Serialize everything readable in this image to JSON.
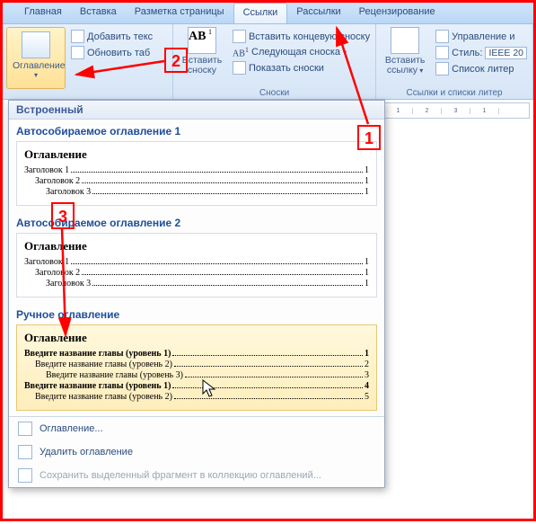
{
  "tabs": {
    "home": "Главная",
    "insert": "Вставка",
    "layout": "Разметка страницы",
    "references": "Ссылки",
    "mailings": "Рассылки",
    "review": "Рецензирование"
  },
  "ribbon": {
    "toc": {
      "label": "Оглавление",
      "add_text": "Добавить текс",
      "update_table": "Обновить таб"
    },
    "footnotes": {
      "group_label": "Сноски",
      "insert_footnote_l1": "Вставить",
      "insert_footnote_l2": "сноску",
      "insert_endnote": "Вставить концевую сноску",
      "next_footnote": "Следующая сноска",
      "show_notes": "Показать сноски"
    },
    "citations": {
      "insert_citation_l1": "Вставить",
      "insert_citation_l2": "ссылку",
      "manage_sources": "Управление и",
      "style_label": "Стиль:",
      "style_value": "IEEE 20",
      "bibliography": "Список литер",
      "group_label": "Ссылки и списки литер"
    }
  },
  "callouts": {
    "n1": "1",
    "n2": "2",
    "n3": "3"
  },
  "gallery": {
    "builtin_header": "Встроенный",
    "auto1_title": "Автособираемое оглавление 1",
    "auto2_title": "Автособираемое оглавление 2",
    "manual_title": "Ручное оглавление",
    "toc_heading": "Оглавление",
    "auto": {
      "h1": "Заголовок 1",
      "p1": "1",
      "h2": "Заголовок 2",
      "p2": "1",
      "h3": "Заголовок 3",
      "p3": "1"
    },
    "manual": {
      "r1": "Введите название главы (уровень 1)",
      "p1": "1",
      "r2": "Введите название главы (уровень 2)",
      "p2": "2",
      "r3": "Введите название главы (уровень 3)",
      "p3": "3",
      "r4": "Введите название главы (уровень 1)",
      "p4": "4",
      "r5": "Введите название главы (уровень 2)",
      "p5": "5"
    },
    "menu": {
      "insert_toc": "Оглавление...",
      "remove_toc": "Удалить оглавление",
      "save_selection": "Сохранить выделенный фрагмент в коллекцию оглавлений..."
    }
  },
  "ruler": {
    "t1": "1",
    "t2": "2",
    "t3": "3",
    "t4": "1"
  }
}
